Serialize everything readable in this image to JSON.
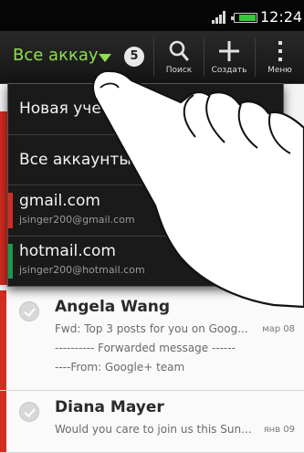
{
  "status_bar": {
    "time": "12:24",
    "battery_level": 0.75,
    "signal_bars": 4
  },
  "action_bar": {
    "account_title": "Все аккау",
    "unread_badge": "5",
    "actions": [
      {
        "label": "Поиск",
        "icon": "search-icon"
      },
      {
        "label": "Создать",
        "icon": "plus-icon"
      },
      {
        "label": "Меню",
        "icon": "menu-icon"
      }
    ]
  },
  "dropdown": {
    "items": [
      {
        "title": "Новая учетная запись",
        "subtitle": "",
        "color": ""
      },
      {
        "title": "Все аккаунты",
        "subtitle": "",
        "color": ""
      },
      {
        "title": "gmail.com",
        "subtitle": "jsinger200@gmail.com",
        "color": "#d42c20"
      },
      {
        "title": "hotmail.com",
        "subtitle": "jsinger200@hotmail.com",
        "color": "#1a9a4a"
      }
    ]
  },
  "emails": [
    {
      "sender": "Angela Wang",
      "preview": "Fwd: Top 3 posts for you on Goog...",
      "date": "мар 08",
      "line2": "---------- Forwarded message ------",
      "line3": "----From: Google+ team",
      "accent": "#d42c20"
    },
    {
      "sender": "Diana Mayer",
      "preview": "Would you care to join us this Sun...",
      "date": "янв 09",
      "accent": "#d42c20"
    }
  ],
  "list_background_fragments": {
    "date_fragment": "08"
  },
  "colors": {
    "accent_green": "#8fe04a",
    "gmail_red": "#d42c20",
    "hotmail_green": "#1a9a4a"
  }
}
